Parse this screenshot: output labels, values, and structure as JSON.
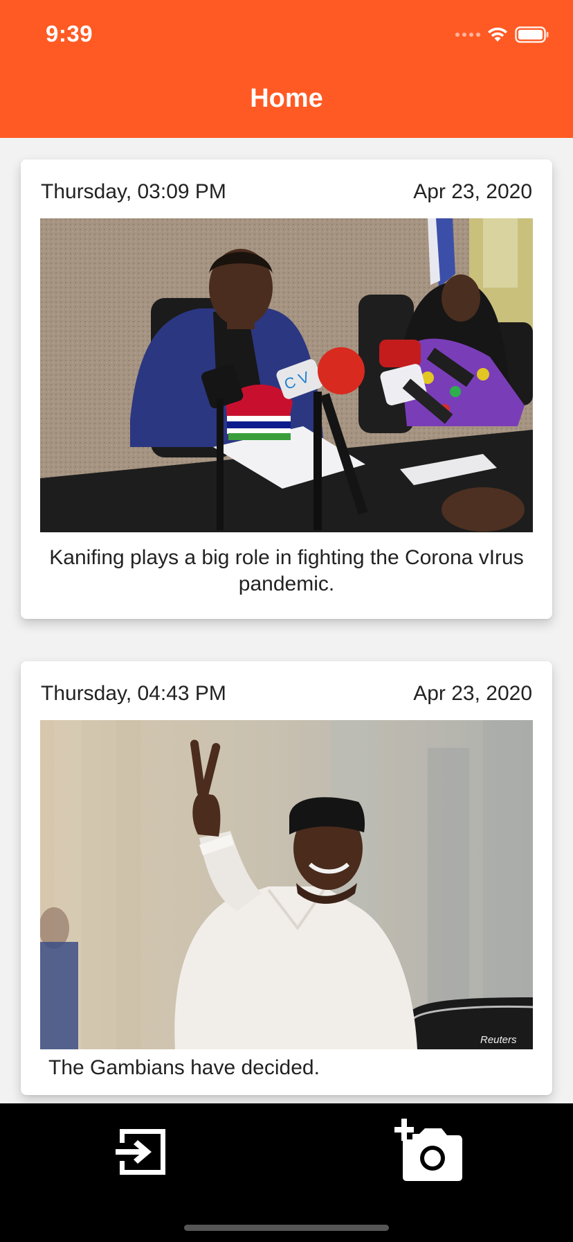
{
  "status_bar": {
    "time": "9:39",
    "icons": [
      "cellular-signal-icon",
      "wifi-icon",
      "battery-icon"
    ]
  },
  "header": {
    "title": "Home",
    "color": "#ff5a24"
  },
  "posts": [
    {
      "day_time": "Thursday, 03:09 PM",
      "date": "Apr 23, 2020",
      "caption": "Kanifing plays a big role in fighting the Corona vIrus pandemic."
    },
    {
      "day_time": "Thursday, 04:43 PM",
      "date": "Apr 23, 2020",
      "caption": "The Gambians have decided.",
      "photo_watermark": "Reuters"
    }
  ],
  "tab_bar": {
    "items": [
      "logout-icon",
      "add-photo-camera-icon"
    ]
  }
}
